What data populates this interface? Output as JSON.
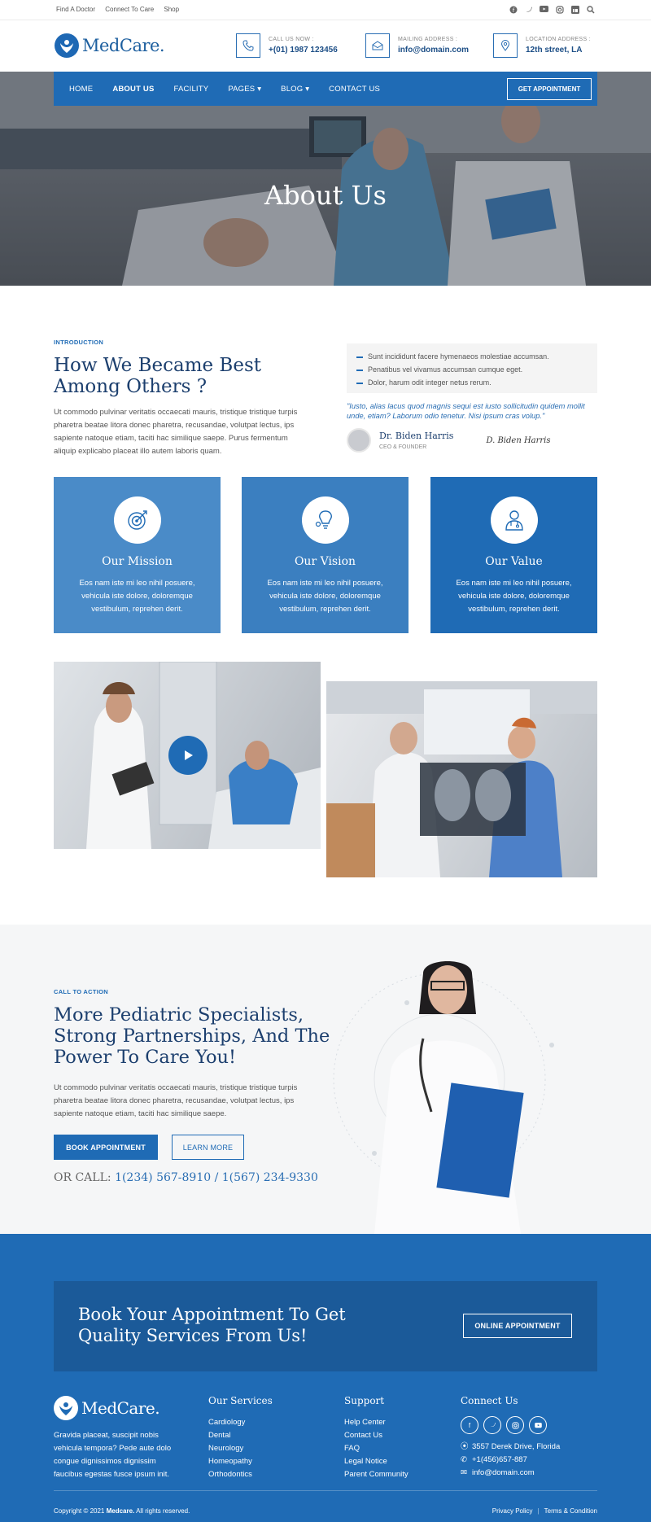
{
  "topbar": {
    "links": [
      "Find A Doctor",
      "Connect To Care",
      "Shop"
    ],
    "social_icons": [
      "facebook-icon",
      "twitter-icon",
      "youtube-icon",
      "instagram-icon",
      "linkedin-icon",
      "search-icon"
    ]
  },
  "header": {
    "logo": "MedCare.",
    "info": [
      {
        "label": "CALL US NOW :",
        "value": "+(01) 1987 123456",
        "icon": "phone-icon"
      },
      {
        "label": "MAILING ADDRESS :",
        "value": "info@domain.com",
        "icon": "mail-icon"
      },
      {
        "label": "LOCATION ADDRESS :",
        "value": "12th street, LA",
        "icon": "location-icon"
      }
    ]
  },
  "nav": {
    "items": [
      "HOME",
      "ABOUT US",
      "FACILITY",
      "PAGES",
      "BLOG",
      "CONTACT US"
    ],
    "active": "ABOUT US",
    "cta": "GET APPOINTMENT"
  },
  "hero": {
    "title": "About Us"
  },
  "intro": {
    "tag": "INTRODUCTION",
    "heading_line1": "How We Became Best",
    "heading_line2": "Among Others ?",
    "body": "Ut commodo pulvinar veritatis occaecati mauris, tristique tristique turpis pharetra beatae litora donec pharetra, recusandae, volutpat lectus, ips sapiente natoque etiam, taciti hac similique saepe. Purus fermentum aliquip explicabo placeat illo autem laboris quam.",
    "list": [
      "Sunt incididunt facere hymenaeos molestiae accumsan.",
      "Penatibus vel vivamus accumsan cumque eget.",
      "Dolor, harum odit integer netus rerum."
    ],
    "quote": "\"Iusto, alias lacus quod magnis sequi est iusto sollicitudin quidem mollit unde, etiam? Laborum odio tenetur. Nisi ipsum cras volup.\"",
    "author_name": "Dr. Biden Harris",
    "author_title": "CEO & FOUNDER",
    "signature": "D. Biden Harris"
  },
  "cards": [
    {
      "title": "Our Mission",
      "text": "Eos nam iste mi leo nihil posuere, vehicula iste dolore, doloremque vestibulum, reprehen derit.",
      "icon": "target-icon",
      "color": "#4a8bc8"
    },
    {
      "title": "Our Vision",
      "text": "Eos nam iste mi leo nihil posuere, vehicula iste dolore, doloremque vestibulum, reprehen derit.",
      "icon": "lightbulb-icon",
      "color": "#3b7fc0"
    },
    {
      "title": "Our Value",
      "text": "Eos nam iste mi leo nihil posuere, vehicula iste dolore, doloremque vestibulum, reprehen derit.",
      "icon": "doctor-icon",
      "color": "#1f6bb5"
    }
  ],
  "cta": {
    "tag": "CALL TO ACTION",
    "heading_line1": "More Pediatric Specialists,",
    "heading_line2": "Strong Partnerships, And The",
    "heading_line3": "Power To Care You!",
    "body": "Ut commodo pulvinar veritatis occaecati mauris, tristique tristique turpis pharetra beatae litora donec pharetra, recusandae, volutpat lectus, ips sapiente natoque etiam, taciti hac similique saepe.",
    "book": "BOOK APPOINTMENT",
    "learn": "LEARN MORE",
    "call_label": "OR CALL:",
    "phones": "1(234) 567-8910 / 1(567) 234-9330"
  },
  "banner": {
    "line1": "Book Your Appointment To Get",
    "line2": "Quality Services From Us!",
    "button": "ONLINE APPOINTMENT"
  },
  "footer": {
    "logo": "MedCare.",
    "about": "Gravida placeat, suscipit nobis vehicula tempora? Pede aute dolo congue dignissimos dignissim faucibus egestas fusce ipsum init.",
    "services_title": "Our Services",
    "services": [
      "Cardiology",
      "Dental",
      "Neurology",
      "Homeopathy",
      "Orthodontics"
    ],
    "support_title": "Support",
    "support": [
      "Help Center",
      "Contact Us",
      "FAQ",
      "Legal Notice",
      "Parent Community"
    ],
    "connect_title": "Connect Us",
    "connect_icons": [
      "facebook-icon",
      "twitter-icon",
      "instagram-icon",
      "youtube-icon"
    ],
    "address": "3557 Derek Drive, Florida",
    "phone": "+1(456)657-887",
    "email": "info@domain.com",
    "copyright_pre": "Copyright © 2021",
    "copyright_brand": "Medcare.",
    "copyright_post": "All rights reserved.",
    "privacy": "Privacy Policy",
    "terms": "Terms & Condition"
  }
}
